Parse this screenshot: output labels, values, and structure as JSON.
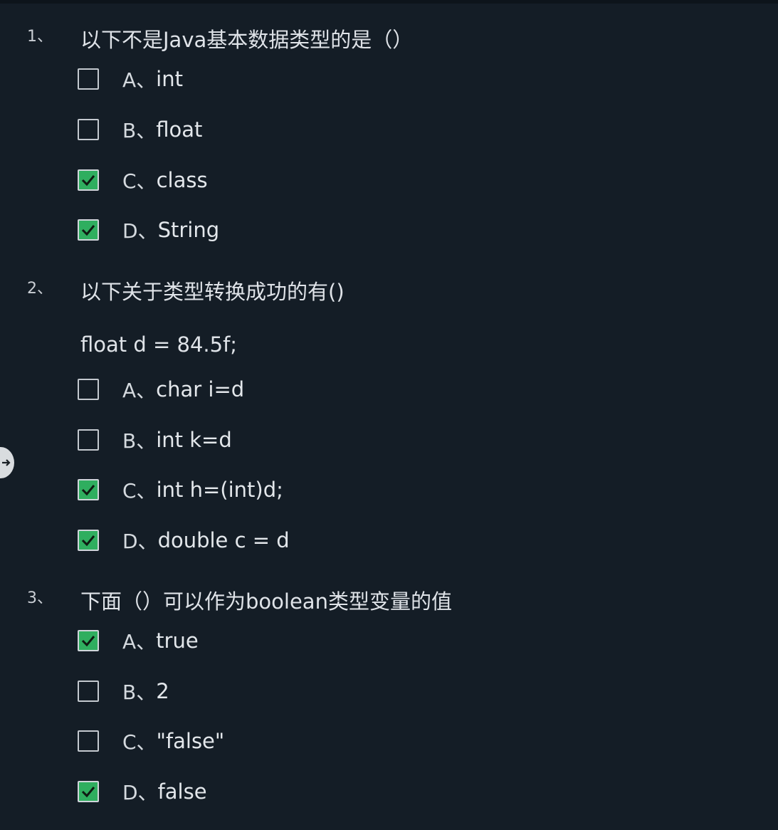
{
  "questions": [
    {
      "number": "1、",
      "text": "以下不是Java基本数据类型的是（）",
      "code": "",
      "options": [
        {
          "letter": "A、",
          "text": "int",
          "checked": false
        },
        {
          "letter": "B、",
          "text": "float",
          "checked": false
        },
        {
          "letter": "C、",
          "text": "class",
          "checked": true
        },
        {
          "letter": "D、",
          "text": "String",
          "checked": true
        }
      ]
    },
    {
      "number": "2、",
      "text": "以下关于类型转换成功的有()",
      "code": "float d = 84.5f;",
      "options": [
        {
          "letter": "A、",
          "text": "char i=d",
          "checked": false
        },
        {
          "letter": "B、",
          "text": "int k=d",
          "checked": false
        },
        {
          "letter": "C、",
          "text": "int h=(int)d;",
          "checked": true
        },
        {
          "letter": "D、",
          "text": "double c = d",
          "checked": true
        }
      ]
    },
    {
      "number": "3、",
      "text": "下面（）可以作为boolean类型变量的值",
      "code": "",
      "options": [
        {
          "letter": "A、",
          "text": "true",
          "checked": true
        },
        {
          "letter": "B、",
          "text": "2",
          "checked": false
        },
        {
          "letter": "C、",
          "text": "\"false\"",
          "checked": false
        },
        {
          "letter": "D、",
          "text": "false",
          "checked": true
        }
      ]
    }
  ],
  "icons": {
    "checkmark": "checkmark-icon",
    "side_handle": "arrow-right-icon"
  },
  "colors": {
    "background": "#141d26",
    "checked": "#2fae5f"
  }
}
